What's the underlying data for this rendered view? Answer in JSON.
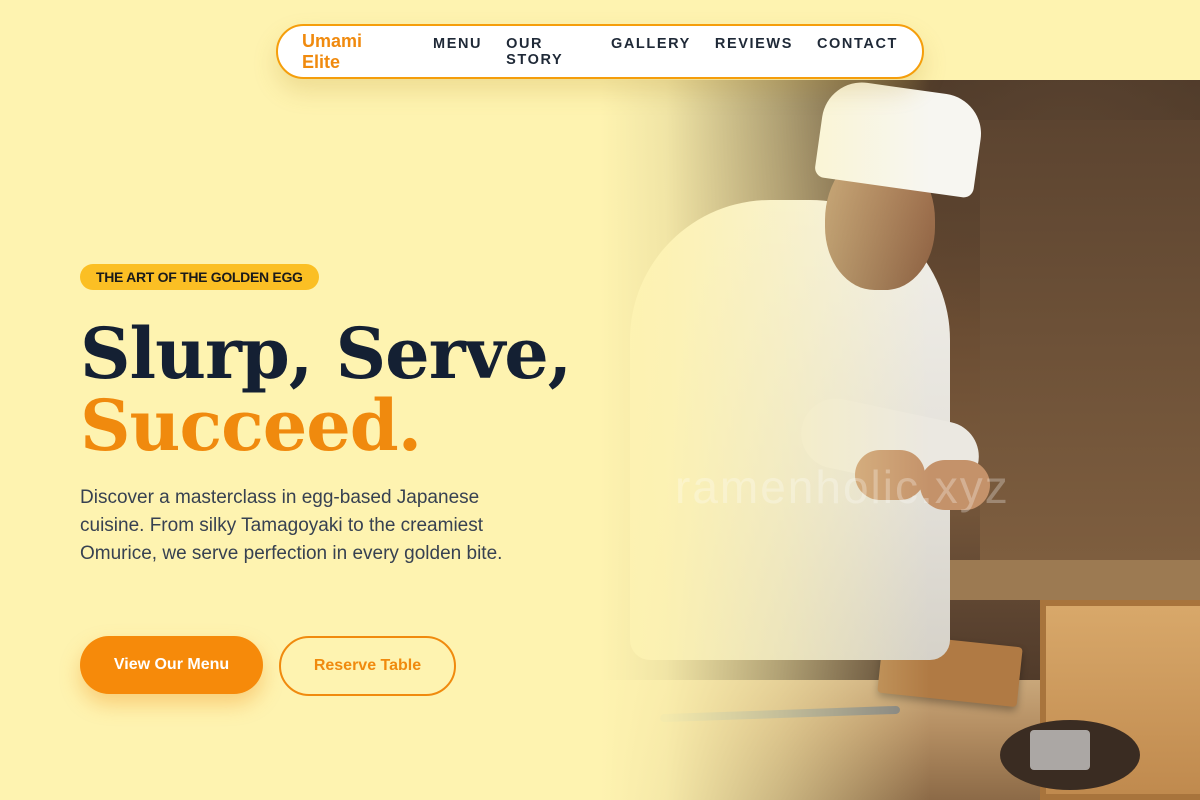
{
  "nav": {
    "brand": "Umami Elite",
    "links": [
      "MENU",
      "OUR STORY",
      "GALLERY",
      "REVIEWS",
      "CONTACT"
    ]
  },
  "hero": {
    "badge": "THE ART OF THE GOLDEN EGG",
    "headline_line1": "Slurp, Serve,",
    "headline_line2": "Succeed.",
    "description": "Discover a masterclass in egg-based Japanese cuisine. From silky Tamagoyaki to the creamiest Omurice, we serve perfection in every golden bite.",
    "primary_button": "View Our Menu",
    "secondary_button": "Reserve Table",
    "image_watermark": "ramenholic.xyz"
  },
  "colors": {
    "background": "#FEF3B0",
    "accent": "#F08A0E",
    "badge": "#FBBF24",
    "heading": "#142033"
  }
}
